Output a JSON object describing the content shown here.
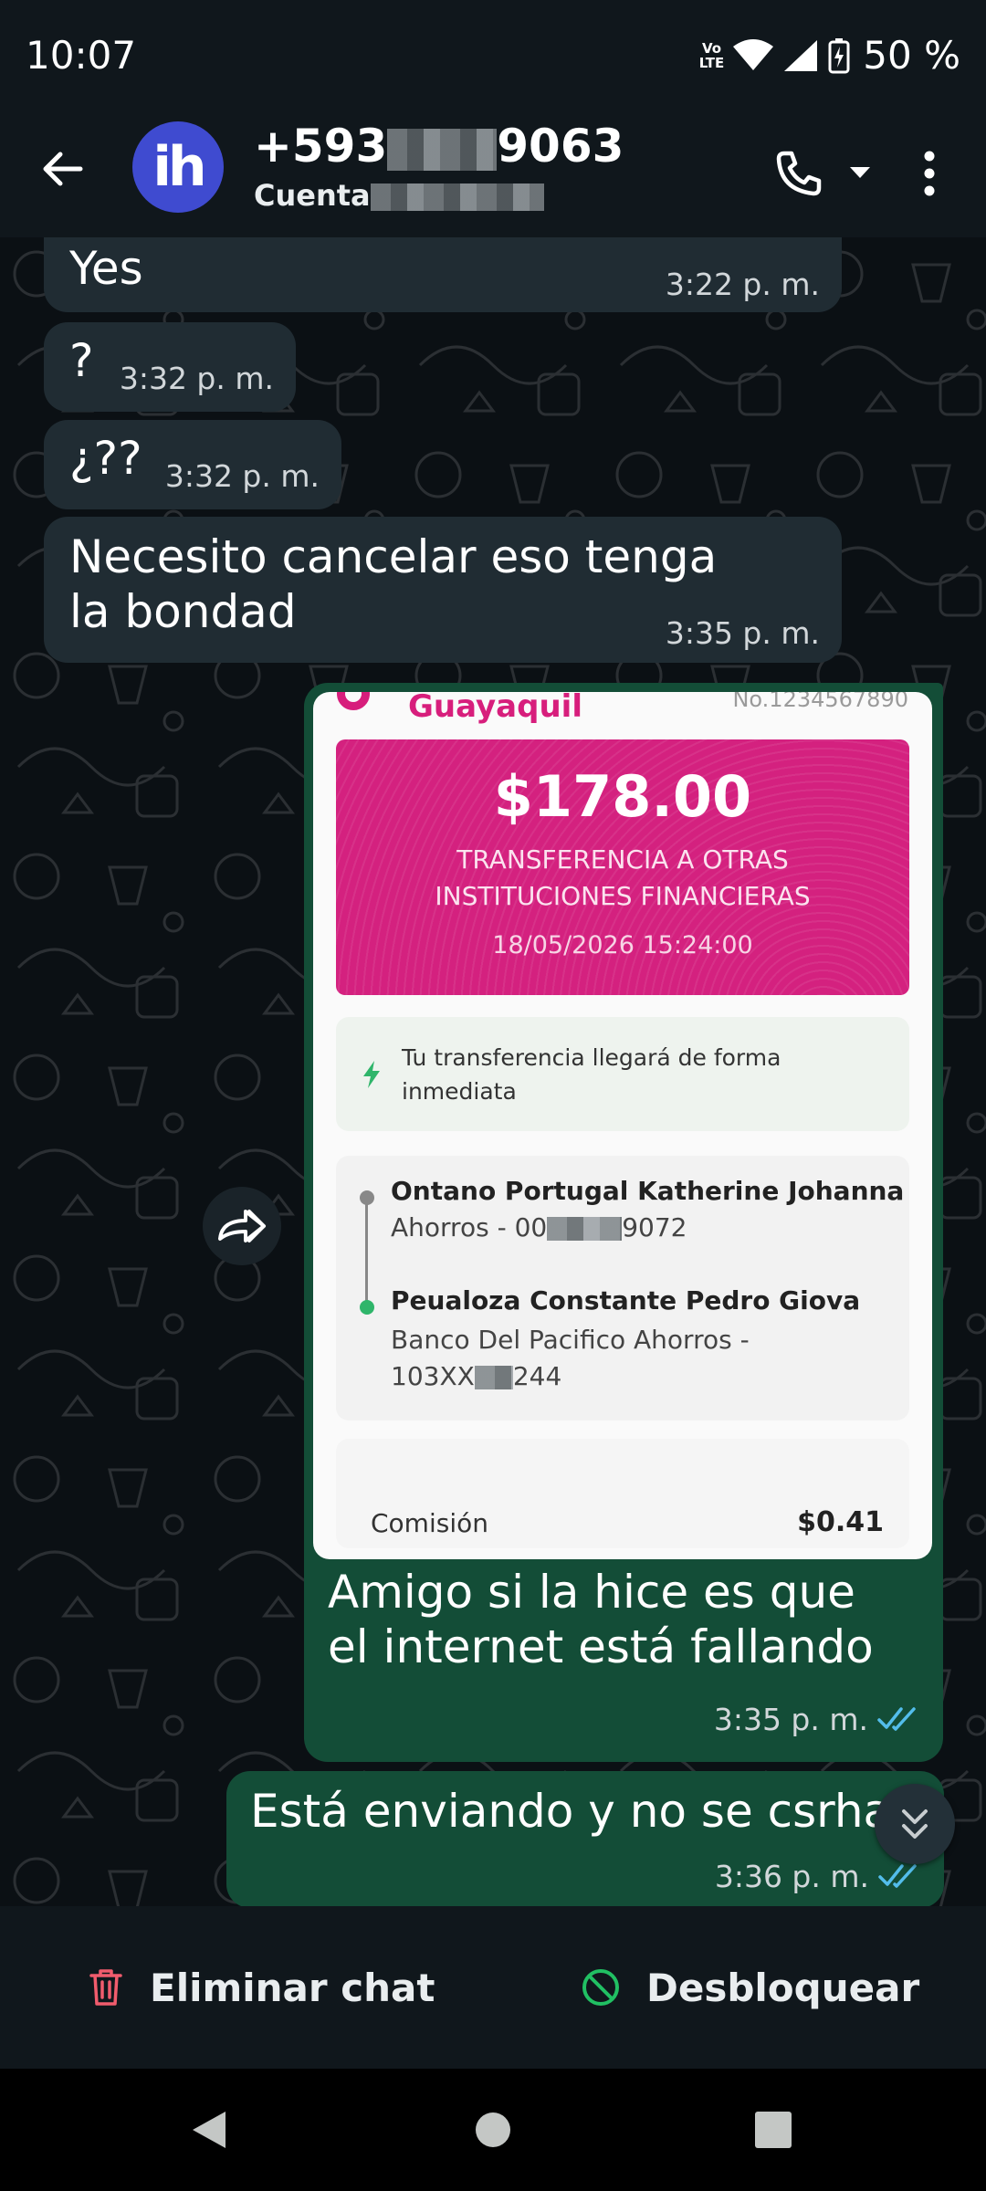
{
  "status_bar": {
    "time": "10:07",
    "network_label_top": "Vo",
    "network_label_bottom": "LTE",
    "battery": "50 %",
    "icons": [
      "volte-icon",
      "wifi-icon",
      "signal-icon",
      "battery-charging-icon"
    ]
  },
  "header": {
    "avatar_initials": "ih",
    "name_prefix": "+593",
    "name_suffix": "9063",
    "subtitle_prefix": "Cuenta",
    "icons": [
      "back-arrow-icon",
      "phone-icon",
      "caret-down-icon",
      "more-vertical-icon"
    ]
  },
  "messages": [
    {
      "direction": "in",
      "text": "Yes",
      "time": "3:22 p. m."
    },
    {
      "direction": "in",
      "text": "?",
      "time": "3:32 p. m."
    },
    {
      "direction": "in",
      "text": "¿??",
      "time": "3:32 p. m."
    },
    {
      "direction": "in",
      "text": "Necesito cancelar eso tenga la bondad",
      "time": "3:35 p. m."
    },
    {
      "direction": "out",
      "type": "image",
      "text": "Amigo si la hice es que el internet está fallando",
      "time": "3:35 p. m.",
      "status": "read"
    },
    {
      "direction": "out",
      "text": "Está enviando y no se csrhaba",
      "time": "3:36 p. m.",
      "status": "read"
    }
  ],
  "receipt": {
    "bank": "Guayaquil",
    "number": "No.1234567890",
    "amount": "$178.00",
    "type_line1": "TRANSFERENCIA A OTRAS",
    "type_line2": "INSTITUCIONES FINANCIERAS",
    "date": "18/05/2026 15:24:00",
    "info": "Tu transferencia llegará de forma inmediata",
    "from_name": "Ontano Portugal Katherine Johanna",
    "from_account_prefix": "Ahorros - 00",
    "from_account_suffix": "9072",
    "to_name": "Peualoza Constante Pedro Giova",
    "to_account_line1": "Banco Del Pacifico Ahorros -",
    "to_account_prefix": "103XX",
    "to_account_suffix": "244",
    "fee_label": "Comisión",
    "fee_value": "$0.41"
  },
  "actions": {
    "delete_chat": "Eliminar chat",
    "unblock": "Desbloquear"
  },
  "colors": {
    "incoming_bubble": "#202c33",
    "outgoing_bubble": "#134d37",
    "read_ticks": "#53bdeb",
    "delete_red": "#f15c6d",
    "unblock_green": "#21c063",
    "receipt_pink": "#d4217f"
  },
  "nav": [
    "back-triangle-icon",
    "home-circle-icon",
    "recents-square-icon"
  ]
}
